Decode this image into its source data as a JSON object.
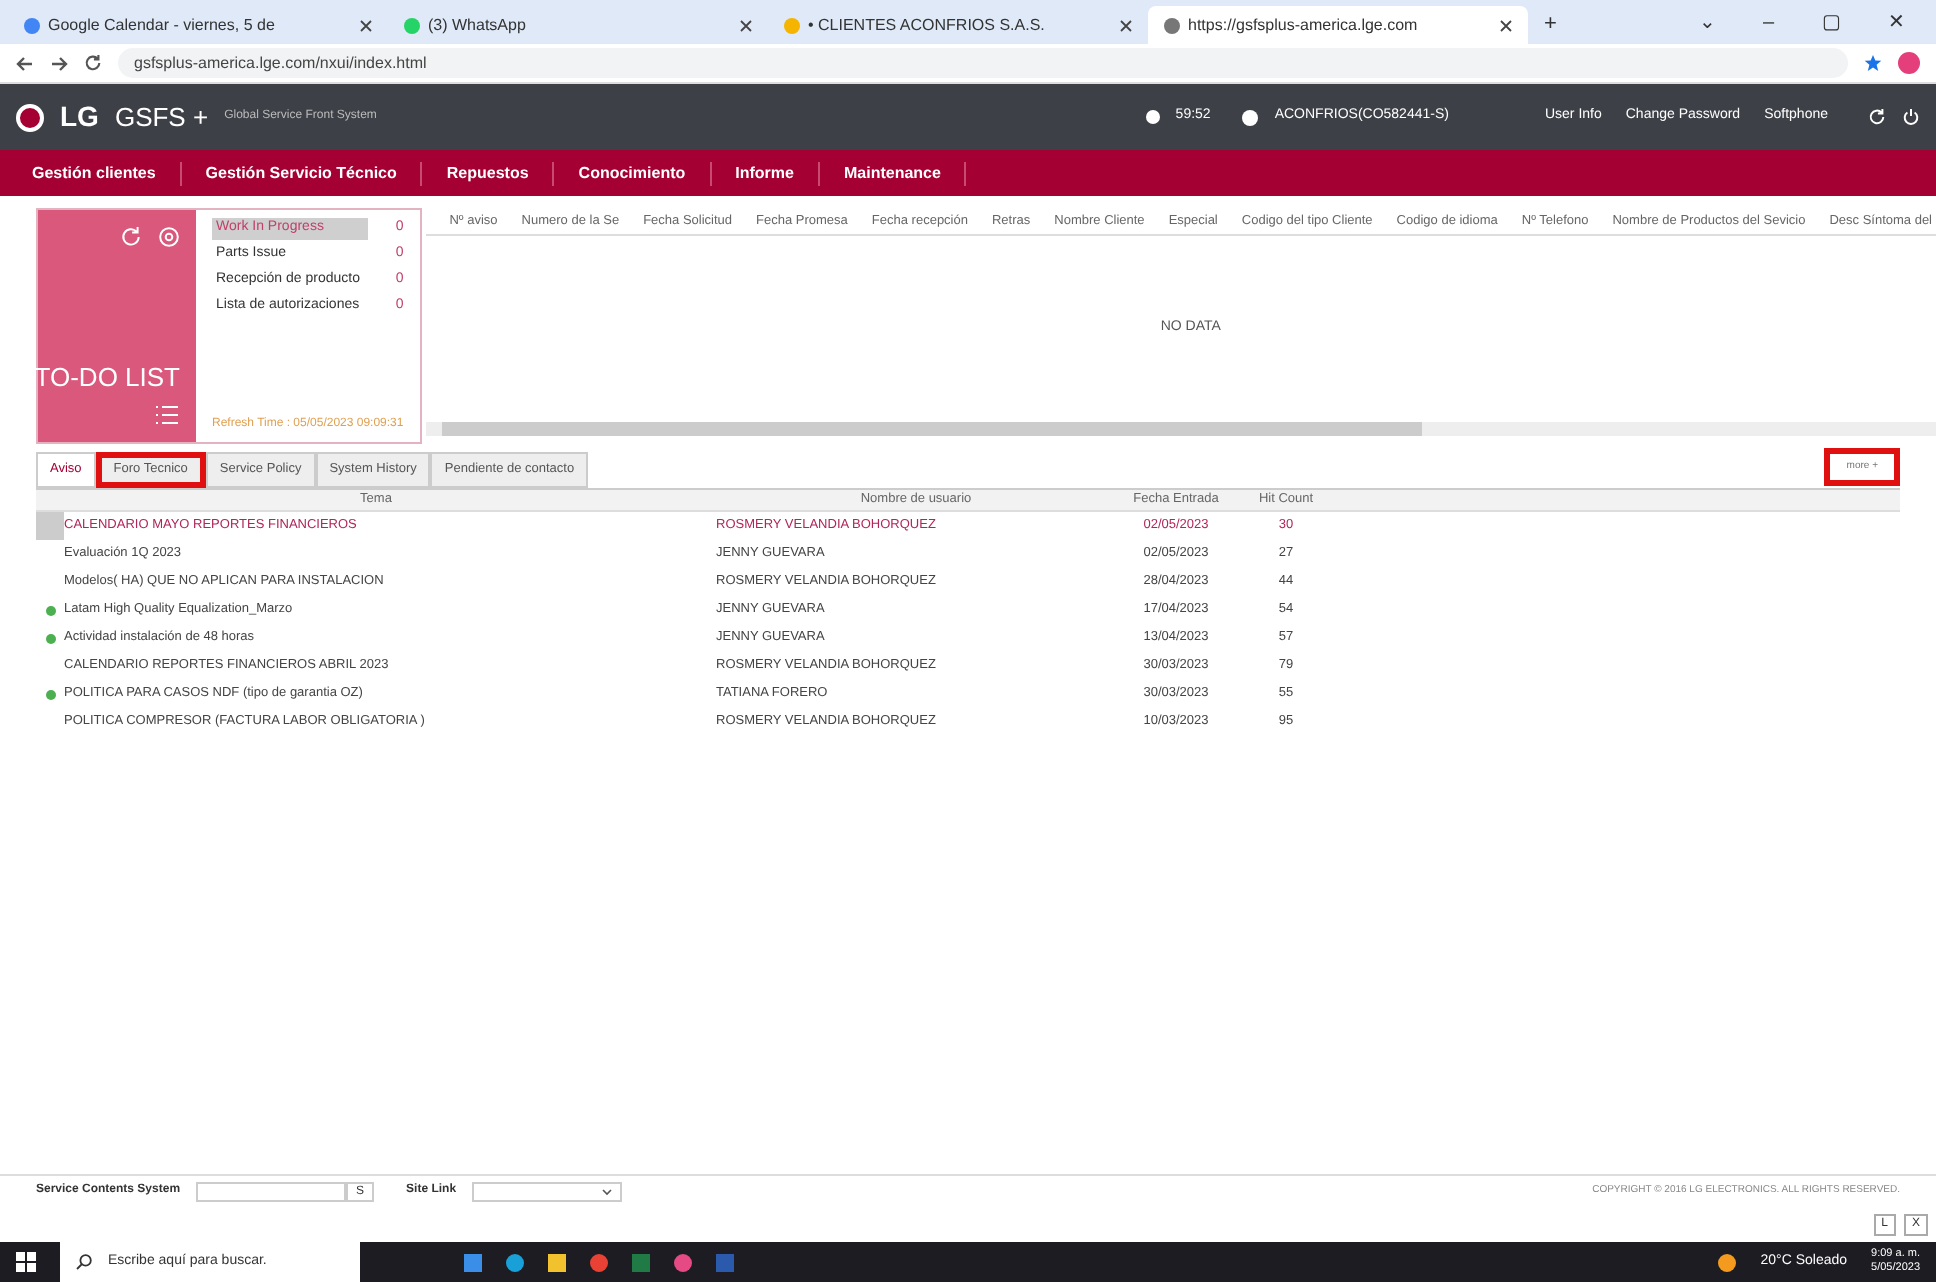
{
  "browser": {
    "tabs": [
      {
        "label": "Google Calendar - viernes, 5 de",
        "selected": false,
        "kind": "calendar"
      },
      {
        "label": "(3) WhatsApp",
        "selected": false,
        "kind": "chat"
      },
      {
        "label": "• CLIENTES ACONFRIOS S.A.S.",
        "selected": false,
        "kind": "drive"
      },
      {
        "label": "https://gsfsplus-america.lge.com",
        "selected": true,
        "kind": "globe"
      }
    ],
    "new_tab": "+",
    "url": "gsfsplus-america.lge.com/nxui/index.html",
    "window_controls": [
      "⌄",
      "–",
      "▢",
      "✕"
    ]
  },
  "header": {
    "logo": "LG",
    "product": "GSFS +",
    "subtitle": "Global Service Front System",
    "timer": "59:52",
    "user": "ACONFRIOS(CO582441-S)",
    "links": [
      "User Info",
      "Change Password",
      "Softphone"
    ]
  },
  "menu": {
    "items": [
      "Gestión clientes",
      "Gestión Servicio Técnico",
      "Repuestos",
      "Conocimiento",
      "Informe",
      "Maintenance"
    ]
  },
  "todo": {
    "title": "TO-DO LIST",
    "items": [
      {
        "label": "Work In Progress",
        "count": "0",
        "selected": true
      },
      {
        "label": "Parts Issue",
        "count": "0",
        "selected": false
      },
      {
        "label": "Recepción de producto",
        "count": "0",
        "selected": false
      },
      {
        "label": "Lista de autorizaciones",
        "count": "0",
        "selected": false
      }
    ],
    "refresh": "Refresh Time : 05/05/2023 09:09:31"
  },
  "grid": {
    "columns": [
      "Nº aviso",
      "Numero de la Se",
      "Fecha Solicitud",
      "Fecha Promesa",
      "Fecha recepción",
      "Retras",
      "Nombre Cliente",
      "Especial",
      "Codigo del tipo Cliente",
      "Codigo de idioma",
      "Nº Telefono",
      "Nombre de Productos del Sevicio",
      "Desc Síntoma del"
    ],
    "empty": "NO DATA"
  },
  "board": {
    "tabs": [
      {
        "label": "Aviso",
        "selected": true,
        "highlighted": false
      },
      {
        "label": "Foro Tecnico",
        "selected": false,
        "highlighted": true
      },
      {
        "label": "Service Policy",
        "selected": false,
        "highlighted": false
      },
      {
        "label": "System History",
        "selected": false,
        "highlighted": false
      },
      {
        "label": "Pendiente de contacto",
        "selected": false,
        "highlighted": false
      }
    ],
    "more": {
      "label": "more +",
      "highlighted": true
    },
    "columns": [
      "Tema",
      "Nombre de usuario",
      "Fecha Entrada",
      "Hit Count"
    ],
    "rows": [
      {
        "cells": [
          "CALENDARIO MAYO REPORTES FINANCIEROS",
          "ROSMERY VELANDIA BOHORQUEZ",
          "02/05/2023",
          "30"
        ],
        "selected": true,
        "new": false
      },
      {
        "cells": [
          "Evaluación 1Q 2023",
          "JENNY GUEVARA",
          "02/05/2023",
          "27"
        ],
        "selected": false,
        "new": false
      },
      {
        "cells": [
          "Modelos( HA) QUE NO APLICAN PARA INSTALACION",
          "ROSMERY VELANDIA BOHORQUEZ",
          "28/04/2023",
          "44"
        ],
        "selected": false,
        "new": false
      },
      {
        "cells": [
          "Latam High Quality Equalization_Marzo",
          "JENNY GUEVARA",
          "17/04/2023",
          "54"
        ],
        "selected": false,
        "new": true
      },
      {
        "cells": [
          "Actividad instalación de 48 horas",
          "JENNY GUEVARA",
          "13/04/2023",
          "57"
        ],
        "selected": false,
        "new": true
      },
      {
        "cells": [
          "CALENDARIO REPORTES FINANCIEROS ABRIL 2023",
          "ROSMERY VELANDIA BOHORQUEZ",
          "30/03/2023",
          "79"
        ],
        "selected": false,
        "new": false
      },
      {
        "cells": [
          "POLITICA PARA CASOS NDF (tipo de garantia OZ)",
          "TATIANA FORERO",
          "30/03/2023",
          "55"
        ],
        "selected": false,
        "new": true
      },
      {
        "cells": [
          "POLITICA COMPRESOR (FACTURA LABOR OBLIGATORIA )",
          "ROSMERY VELANDIA BOHORQUEZ",
          "10/03/2023",
          "95"
        ],
        "selected": false,
        "new": false
      }
    ]
  },
  "footer": {
    "service_label": "Service Contents System",
    "service_button": "S",
    "site_label": "Site Link",
    "copyright": "COPYRIGHT © 2016 LG ELECTRONICS. ALL RIGHTS RESERVED.",
    "corner_buttons": [
      "L",
      "X"
    ]
  },
  "taskbar": {
    "search_placeholder": "Escribe aquí para buscar.",
    "weather": "20°C  Soleado",
    "time": "9:09 a. m.",
    "date": "5/05/2023"
  }
}
